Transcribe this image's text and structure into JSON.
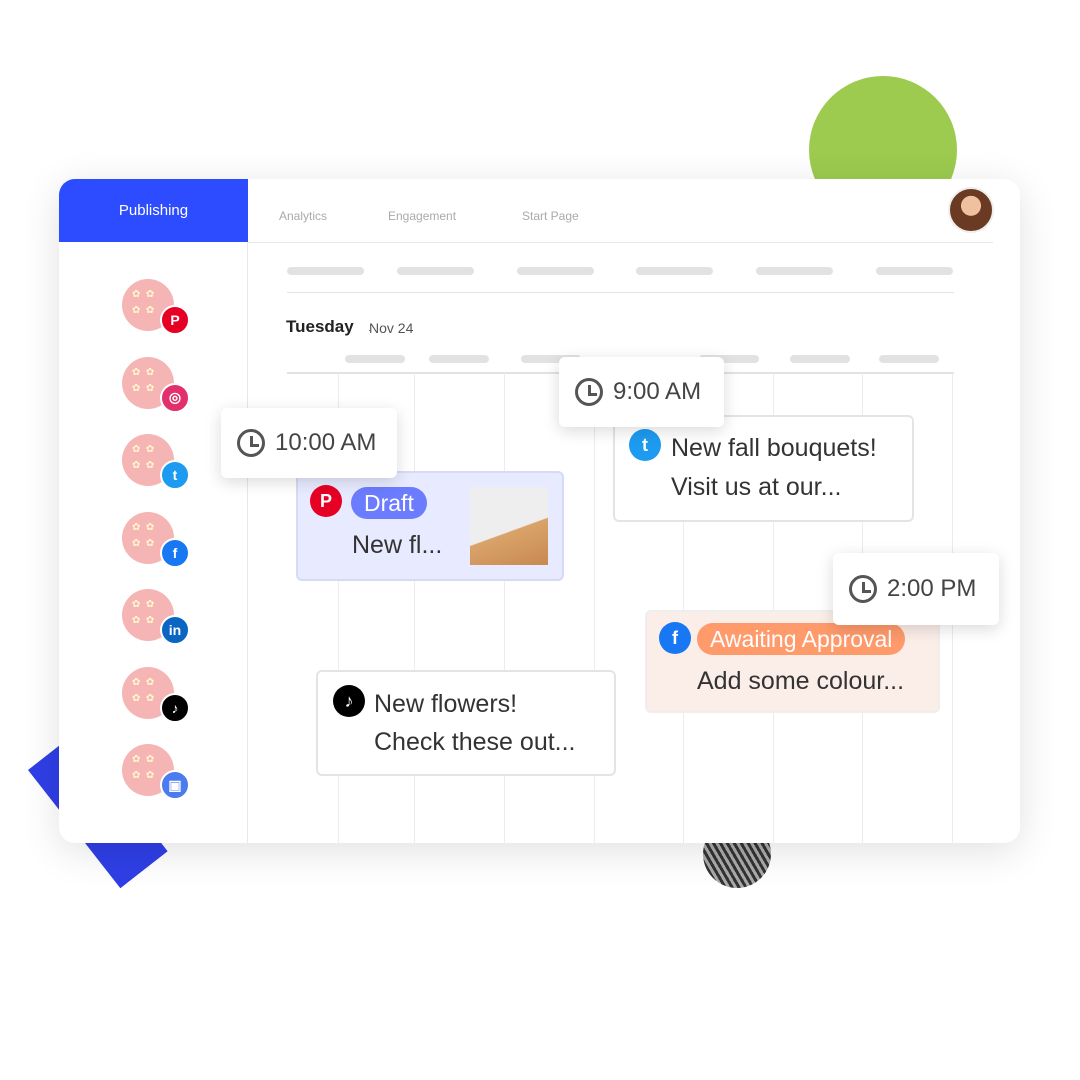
{
  "nav": {
    "tabs": [
      {
        "label": "Publishing",
        "active": true
      },
      {
        "label": "Analytics"
      },
      {
        "label": "Engagement"
      },
      {
        "label": "Start Page"
      }
    ]
  },
  "accounts": [
    {
      "network": "pinterest",
      "icon": "pinterest-icon",
      "glyph": "P",
      "color": "#e60023"
    },
    {
      "network": "instagram",
      "icon": "instagram-icon",
      "glyph": "◎",
      "color": "#e1306c"
    },
    {
      "network": "twitter",
      "icon": "twitter-icon",
      "glyph": "t",
      "color": "#1d9bf0"
    },
    {
      "network": "facebook",
      "icon": "facebook-icon",
      "glyph": "f",
      "color": "#1877f2"
    },
    {
      "network": "linkedin",
      "icon": "linkedin-icon",
      "glyph": "in",
      "color": "#0a66c2"
    },
    {
      "network": "tiktok",
      "icon": "tiktok-icon",
      "glyph": "♪",
      "color": "#000000"
    },
    {
      "network": "google-business",
      "icon": "store-icon",
      "glyph": "▣",
      "color": "#4a7cf0"
    }
  ],
  "calendar": {
    "day": "Tuesday",
    "separator": "·",
    "date": "Nov 24"
  },
  "times": {
    "t1": "10:00 AM",
    "t2": "9:00 AM",
    "t3": "2:00 PM"
  },
  "posts": {
    "pinterest": {
      "status": "Draft",
      "text": "New fl...",
      "status_color": "#6b7cff"
    },
    "twitter": {
      "line1": "New fall bouquets!",
      "line2": "Visit us at our..."
    },
    "facebook": {
      "status": "Awaiting Approval",
      "text": "Add some colour...",
      "status_color": "#ff9a6b"
    },
    "tiktok": {
      "line1": "New flowers!",
      "line2": "Check these out..."
    }
  },
  "colors": {
    "accent": "#2d4bff"
  }
}
